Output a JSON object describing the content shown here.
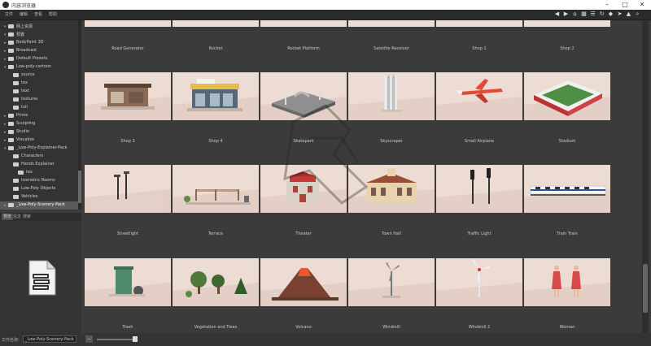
{
  "window": {
    "title": "内容浏览器"
  },
  "menu": [
    "文件",
    "编辑",
    "查看",
    "帮助"
  ],
  "tree": [
    {
      "label": "网上资源",
      "depth": 1,
      "expanded": true
    },
    {
      "label": "预置",
      "depth": 1,
      "expanded": true
    },
    {
      "label": "BodyPaint 3D",
      "depth": 1,
      "expanded": false
    },
    {
      "label": "Broadcast",
      "depth": 1,
      "expanded": false
    },
    {
      "label": "Default Presets",
      "depth": 1,
      "expanded": false
    },
    {
      "label": "Low-poly-cartoon",
      "depth": 1,
      "expanded": true
    },
    {
      "label": "source",
      "depth": 2,
      "expanded": null
    },
    {
      "label": "tex",
      "depth": 2,
      "expanded": null
    },
    {
      "label": "text",
      "depth": 2,
      "expanded": null
    },
    {
      "label": "textures",
      "depth": 2,
      "expanded": null
    },
    {
      "label": "tull",
      "depth": 2,
      "expanded": null
    },
    {
      "label": "Prime",
      "depth": 1,
      "expanded": false
    },
    {
      "label": "Sculpting",
      "depth": 1,
      "expanded": false
    },
    {
      "label": "Studio",
      "depth": 1,
      "expanded": false
    },
    {
      "label": "Visualize",
      "depth": 1,
      "expanded": false
    },
    {
      "label": "_Low-Poly-Explainer-Pack",
      "depth": 1,
      "expanded": true
    },
    {
      "label": "Characters",
      "depth": 2,
      "expanded": null
    },
    {
      "label": "Hands Explainer",
      "depth": 2,
      "expanded": null
    },
    {
      "label": "tex",
      "depth": 3,
      "expanded": null
    },
    {
      "label": "Isometric Rooms",
      "depth": 2,
      "expanded": null
    },
    {
      "label": "Low-Poly Objects",
      "depth": 2,
      "expanded": null
    },
    {
      "label": "Vehicles",
      "depth": 2,
      "expanded": null
    },
    {
      "label": "_Low-Poly-Scenery-Pack",
      "depth": 1,
      "expanded": false,
      "selected": true
    }
  ],
  "tabs": [
    "预览",
    "信息",
    "搜索"
  ],
  "path": {
    "label": "文件名称:",
    "value": "_Low-Poly-Scenery-Pack"
  },
  "grid": {
    "rows": [
      {
        "captions": [
          "Road Generator",
          "Rocket",
          "Rocket Platform",
          "Satellite Receiver",
          "Shop 1",
          "Shop 2"
        ],
        "thumbs": []
      },
      {
        "captions": [
          "Shop 3",
          "Shop 4",
          "Skatepark",
          "Skyscraper",
          "Small Airplane",
          "Stadium"
        ],
        "thumbs": [
          "shop-3",
          "shop-4",
          "skatepark",
          "skyscraper",
          "small-airplane",
          "stadium"
        ]
      },
      {
        "captions": [
          "Streetlight",
          "Terrace",
          "Theater",
          "Town Hall",
          "Traffic Light",
          "Train Train"
        ],
        "thumbs": [
          "streetlight",
          "terrace",
          "theater",
          "town-hall",
          "traffic-light",
          "train"
        ]
      },
      {
        "captions": [
          "Trash",
          "Vegetation and Trees",
          "Volcano",
          "Windmill",
          "Windmill 2",
          "Woman"
        ],
        "thumbs": [
          "trash",
          "vegetation",
          "volcano",
          "windmill",
          "windmill-2",
          "woman"
        ]
      }
    ]
  },
  "colors": {
    "thumb_bg": "#ecdcd4",
    "window_bg": "#3b3b3b",
    "panel_bg": "#333333"
  }
}
